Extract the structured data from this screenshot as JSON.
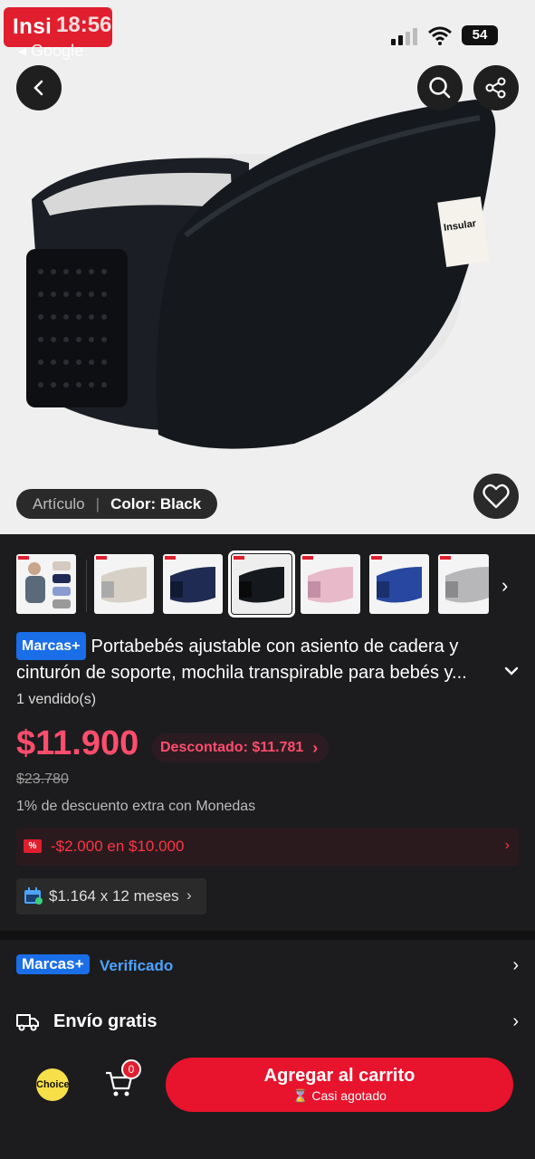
{
  "status_bar": {
    "brand_overlay": "Insi",
    "time": "18:56",
    "back_to": "◂ Google",
    "battery": "54"
  },
  "hero": {
    "article_label": "Artículo",
    "color_label": "Color: Black",
    "product_label_text": "Insular"
  },
  "title": {
    "brand_badge": "Marcas+",
    "text": "Portabebés ajustable con asiento de cadera y cinturón de soporte, mochila transpirable para bebés y..."
  },
  "sold": "1 vendido(s)",
  "price": {
    "current": "$11.900",
    "discount_label": "Descontado: $11.781",
    "original": "$23.780",
    "coins_note": "1% de descuento extra con Monedas"
  },
  "coupon": {
    "icon_text": "%",
    "text": "-$2.000 en $10.000"
  },
  "installments": {
    "text": "$1.164 x 12 meses"
  },
  "marcas_row": {
    "badge": "Marcas+",
    "label": "Verificado"
  },
  "shipping": {
    "label": "Envío gratis"
  },
  "bottom_bar": {
    "choice_label": "Choice",
    "cart_count": "0",
    "add_to_cart": "Agregar al carrito",
    "stock_note": "⌛ Casi agotado"
  },
  "thumbnails": [
    "hero",
    "beige",
    "navy",
    "black",
    "pink",
    "blue",
    "grey"
  ],
  "colors": {
    "accent": "#e8132d",
    "price": "#ff4d6d",
    "brand_badge": "#1a6ee8",
    "verified": "#4da3ff"
  }
}
